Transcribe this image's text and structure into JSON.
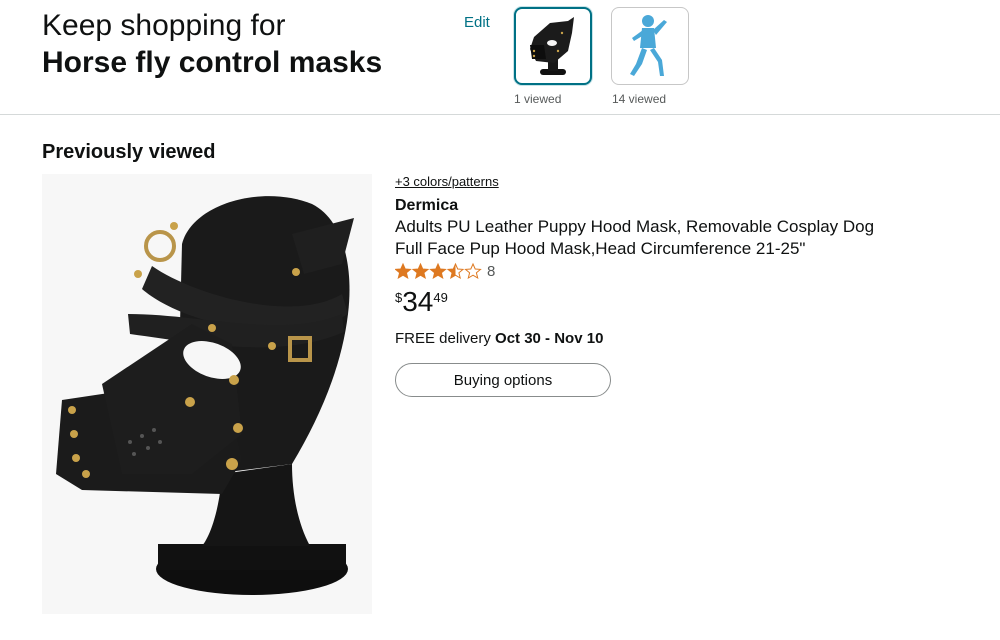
{
  "header": {
    "line1": "Keep shopping for",
    "line2": "Horse fly control masks",
    "edit_label": "Edit"
  },
  "history": [
    {
      "caption": "1 viewed",
      "icon": "puppy-mask-thumbnail",
      "selected": true
    },
    {
      "caption": "14 viewed",
      "icon": "blue-bodysuit-thumbnail",
      "selected": false
    }
  ],
  "section": {
    "title": "Previously viewed"
  },
  "product": {
    "colors_link": "+3 colors/patterns",
    "brand": "Dermica",
    "title_line1": "Adults PU Leather Puppy Hood Mask, Removable Cosplay Dog",
    "title_line2": "Full Face Pup Hood Mask,Head Circumference 21-25\"",
    "rating_value": 3.5,
    "rating_count": "8",
    "price_symbol": "$",
    "price_whole": "34",
    "price_fraction": "49",
    "delivery_prefix": "FREE delivery ",
    "delivery_dates": "Oct 30 - Nov 10",
    "buying_options_label": "Buying options",
    "star_color": "#de7921",
    "image_icon": "leather-puppy-hood-mask-image"
  },
  "colors": {
    "link": "#007185",
    "selected_border": "#007185"
  }
}
